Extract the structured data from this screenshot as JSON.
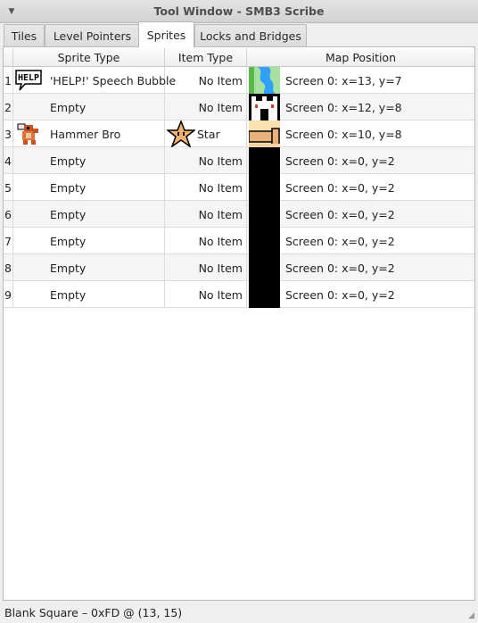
{
  "window": {
    "title": "Tool Window - SMB3 Scribe"
  },
  "tabs": [
    {
      "label": "Tiles"
    },
    {
      "label": "Level Pointers"
    },
    {
      "label": "Sprites"
    },
    {
      "label": "Locks and Bridges"
    }
  ],
  "table": {
    "headers": {
      "sprite_type": "Sprite Type",
      "item_type": "Item Type",
      "map_position": "Map Position"
    },
    "rows": [
      {
        "num": "1",
        "sprite": "'HELP!' Speech Bubble",
        "sprite_icon": "help-bubble-icon",
        "item": "No Item",
        "item_icon": "",
        "map_thumb": "waterfall-thumb",
        "map": "Screen 0: x=13, y=7"
      },
      {
        "num": "2",
        "sprite": "Empty",
        "sprite_icon": "",
        "item": "No Item",
        "item_icon": "",
        "map_thumb": "castle-thumb",
        "map": "Screen 0: x=12, y=8"
      },
      {
        "num": "3",
        "sprite": "Hammer Bro",
        "sprite_icon": "hammer-bro-icon",
        "item": "Star",
        "item_icon": "star-icon",
        "map_thumb": "pipe-thumb",
        "map": "Screen 0: x=10, y=8"
      },
      {
        "num": "4",
        "sprite": "Empty",
        "sprite_icon": "",
        "item": "No Item",
        "item_icon": "",
        "map_thumb": "blank-thumb",
        "map": "Screen 0: x=0, y=2"
      },
      {
        "num": "5",
        "sprite": "Empty",
        "sprite_icon": "",
        "item": "No Item",
        "item_icon": "",
        "map_thumb": "blank-thumb",
        "map": "Screen 0: x=0, y=2"
      },
      {
        "num": "6",
        "sprite": "Empty",
        "sprite_icon": "",
        "item": "No Item",
        "item_icon": "",
        "map_thumb": "blank-thumb",
        "map": "Screen 0: x=0, y=2"
      },
      {
        "num": "7",
        "sprite": "Empty",
        "sprite_icon": "",
        "item": "No Item",
        "item_icon": "",
        "map_thumb": "blank-thumb",
        "map": "Screen 0: x=0, y=2"
      },
      {
        "num": "8",
        "sprite": "Empty",
        "sprite_icon": "",
        "item": "No Item",
        "item_icon": "",
        "map_thumb": "blank-thumb",
        "map": "Screen 0: x=0, y=2"
      },
      {
        "num": "9",
        "sprite": "Empty",
        "sprite_icon": "",
        "item": "No Item",
        "item_icon": "",
        "map_thumb": "blank-thumb",
        "map": "Screen 0: x=0, y=2"
      }
    ]
  },
  "status": {
    "text": "Blank Square – 0xFD @ (13, 15)"
  },
  "colors": {
    "window_bg": "#efefef",
    "table_bg": "#ffffff",
    "alt_row": "#f5f5f5",
    "thumb_bg": "#000000"
  }
}
